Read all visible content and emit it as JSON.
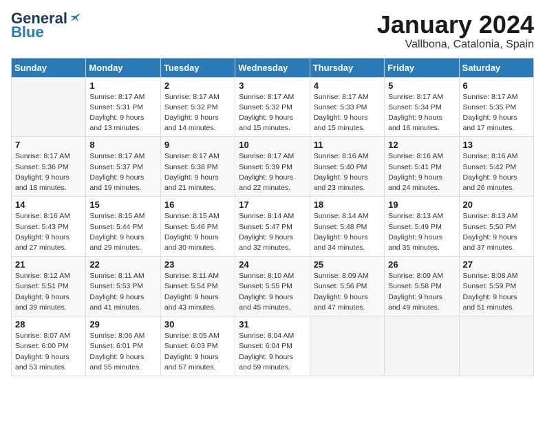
{
  "header": {
    "logo_general": "General",
    "logo_blue": "Blue",
    "title": "January 2024",
    "subtitle": "Vallbona, Catalonia, Spain"
  },
  "weekdays": [
    "Sunday",
    "Monday",
    "Tuesday",
    "Wednesday",
    "Thursday",
    "Friday",
    "Saturday"
  ],
  "weeks": [
    [
      {
        "day": "",
        "info": ""
      },
      {
        "day": "1",
        "info": "Sunrise: 8:17 AM\nSunset: 5:31 PM\nDaylight: 9 hours\nand 13 minutes."
      },
      {
        "day": "2",
        "info": "Sunrise: 8:17 AM\nSunset: 5:32 PM\nDaylight: 9 hours\nand 14 minutes."
      },
      {
        "day": "3",
        "info": "Sunrise: 8:17 AM\nSunset: 5:32 PM\nDaylight: 9 hours\nand 15 minutes."
      },
      {
        "day": "4",
        "info": "Sunrise: 8:17 AM\nSunset: 5:33 PM\nDaylight: 9 hours\nand 15 minutes."
      },
      {
        "day": "5",
        "info": "Sunrise: 8:17 AM\nSunset: 5:34 PM\nDaylight: 9 hours\nand 16 minutes."
      },
      {
        "day": "6",
        "info": "Sunrise: 8:17 AM\nSunset: 5:35 PM\nDaylight: 9 hours\nand 17 minutes."
      }
    ],
    [
      {
        "day": "7",
        "info": "Sunrise: 8:17 AM\nSunset: 5:36 PM\nDaylight: 9 hours\nand 18 minutes."
      },
      {
        "day": "8",
        "info": "Sunrise: 8:17 AM\nSunset: 5:37 PM\nDaylight: 9 hours\nand 19 minutes."
      },
      {
        "day": "9",
        "info": "Sunrise: 8:17 AM\nSunset: 5:38 PM\nDaylight: 9 hours\nand 21 minutes."
      },
      {
        "day": "10",
        "info": "Sunrise: 8:17 AM\nSunset: 5:39 PM\nDaylight: 9 hours\nand 22 minutes."
      },
      {
        "day": "11",
        "info": "Sunrise: 8:16 AM\nSunset: 5:40 PM\nDaylight: 9 hours\nand 23 minutes."
      },
      {
        "day": "12",
        "info": "Sunrise: 8:16 AM\nSunset: 5:41 PM\nDaylight: 9 hours\nand 24 minutes."
      },
      {
        "day": "13",
        "info": "Sunrise: 8:16 AM\nSunset: 5:42 PM\nDaylight: 9 hours\nand 26 minutes."
      }
    ],
    [
      {
        "day": "14",
        "info": "Sunrise: 8:16 AM\nSunset: 5:43 PM\nDaylight: 9 hours\nand 27 minutes."
      },
      {
        "day": "15",
        "info": "Sunrise: 8:15 AM\nSunset: 5:44 PM\nDaylight: 9 hours\nand 29 minutes."
      },
      {
        "day": "16",
        "info": "Sunrise: 8:15 AM\nSunset: 5:46 PM\nDaylight: 9 hours\nand 30 minutes."
      },
      {
        "day": "17",
        "info": "Sunrise: 8:14 AM\nSunset: 5:47 PM\nDaylight: 9 hours\nand 32 minutes."
      },
      {
        "day": "18",
        "info": "Sunrise: 8:14 AM\nSunset: 5:48 PM\nDaylight: 9 hours\nand 34 minutes."
      },
      {
        "day": "19",
        "info": "Sunrise: 8:13 AM\nSunset: 5:49 PM\nDaylight: 9 hours\nand 35 minutes."
      },
      {
        "day": "20",
        "info": "Sunrise: 8:13 AM\nSunset: 5:50 PM\nDaylight: 9 hours\nand 37 minutes."
      }
    ],
    [
      {
        "day": "21",
        "info": "Sunrise: 8:12 AM\nSunset: 5:51 PM\nDaylight: 9 hours\nand 39 minutes."
      },
      {
        "day": "22",
        "info": "Sunrise: 8:11 AM\nSunset: 5:53 PM\nDaylight: 9 hours\nand 41 minutes."
      },
      {
        "day": "23",
        "info": "Sunrise: 8:11 AM\nSunset: 5:54 PM\nDaylight: 9 hours\nand 43 minutes."
      },
      {
        "day": "24",
        "info": "Sunrise: 8:10 AM\nSunset: 5:55 PM\nDaylight: 9 hours\nand 45 minutes."
      },
      {
        "day": "25",
        "info": "Sunrise: 8:09 AM\nSunset: 5:56 PM\nDaylight: 9 hours\nand 47 minutes."
      },
      {
        "day": "26",
        "info": "Sunrise: 8:09 AM\nSunset: 5:58 PM\nDaylight: 9 hours\nand 49 minutes."
      },
      {
        "day": "27",
        "info": "Sunrise: 8:08 AM\nSunset: 5:59 PM\nDaylight: 9 hours\nand 51 minutes."
      }
    ],
    [
      {
        "day": "28",
        "info": "Sunrise: 8:07 AM\nSunset: 6:00 PM\nDaylight: 9 hours\nand 53 minutes."
      },
      {
        "day": "29",
        "info": "Sunrise: 8:06 AM\nSunset: 6:01 PM\nDaylight: 9 hours\nand 55 minutes."
      },
      {
        "day": "30",
        "info": "Sunrise: 8:05 AM\nSunset: 6:03 PM\nDaylight: 9 hours\nand 57 minutes."
      },
      {
        "day": "31",
        "info": "Sunrise: 8:04 AM\nSunset: 6:04 PM\nDaylight: 9 hours\nand 59 minutes."
      },
      {
        "day": "",
        "info": ""
      },
      {
        "day": "",
        "info": ""
      },
      {
        "day": "",
        "info": ""
      }
    ]
  ]
}
